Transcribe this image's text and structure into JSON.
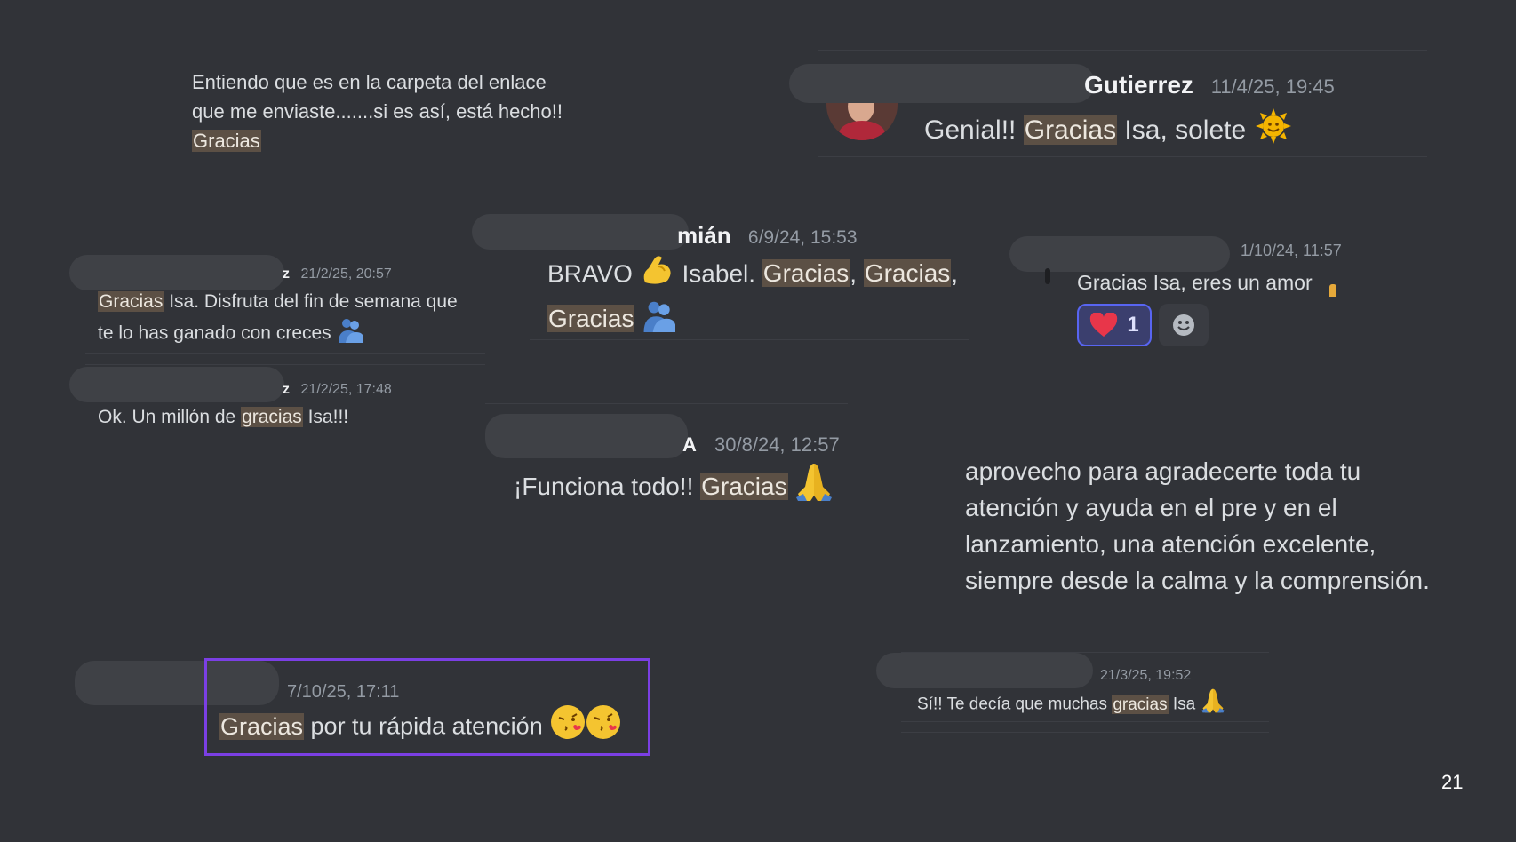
{
  "page_number": "21",
  "msg_carpeta": {
    "line1": "Entiendo que es en la carpeta del enlace",
    "line2": "que me enviaste.......si es así, está hecho!!",
    "hl": "Gracias"
  },
  "msg_genial": {
    "author": "Gutierrez",
    "time": "11/4/25, 19:45",
    "pre": "Genial!! ",
    "hl": "Gracias",
    "post": " Isa, solete"
  },
  "msg_fin_semana": {
    "author_tail": "z",
    "time": "21/2/25, 20:57",
    "hl": "Gracias",
    "post1": " Isa. Disfruta del fin de semana que",
    "line2": "te lo has ganado con creces"
  },
  "msg_millon": {
    "author_tail": "z",
    "time": "21/2/25, 17:48",
    "pre": "Ok. Un millón de ",
    "hl": "gracias",
    "post": " Isa!!!"
  },
  "msg_bravo": {
    "author_tail": "mián",
    "time": "6/9/24, 15:53",
    "pre": "BRAVO",
    "mid": " Isabel. ",
    "hl1": "Gracias",
    "sep1": ", ",
    "hl2": "Gracias",
    "sep2": ",",
    "hl3": "Gracias"
  },
  "msg_amor": {
    "time": "1/10/24, 11:57",
    "text": "Gracias Isa, eres un amor",
    "reaction_count": "1"
  },
  "msg_funciona": {
    "author_tail": "A",
    "time": "30/8/24, 12:57",
    "pre": "¡Funciona todo!! ",
    "hl": "Gracias"
  },
  "msg_aprovecho": {
    "line1": "aprovecho para agradecerte toda tu",
    "line2": "atención y ayuda en el pre y en el",
    "line3": "lanzamiento, una atención excelente,",
    "line4": "siempre desde la calma y la comprensión."
  },
  "msg_rapida": {
    "time": "7/10/25, 17:11",
    "hl": "Gracias",
    "post": " por tu rápida atención"
  },
  "msg_si": {
    "time": "21/3/25, 19:52",
    "pre": "Sí!! Te decía que muchas ",
    "hl": "gracias",
    "post": " Isa"
  },
  "icons": [
    "flexed-biceps-emoji",
    "people-hugging-emoji",
    "sun-emoji",
    "folded-hands-emoji",
    "kissing-heart-emoji",
    "heart-reaction-icon",
    "add-reaction-icon"
  ],
  "colors": {
    "background": "#313338",
    "highlight": "#5c5045",
    "reaction_border": "#5865f2",
    "selection_box": "#7b3fe4"
  }
}
